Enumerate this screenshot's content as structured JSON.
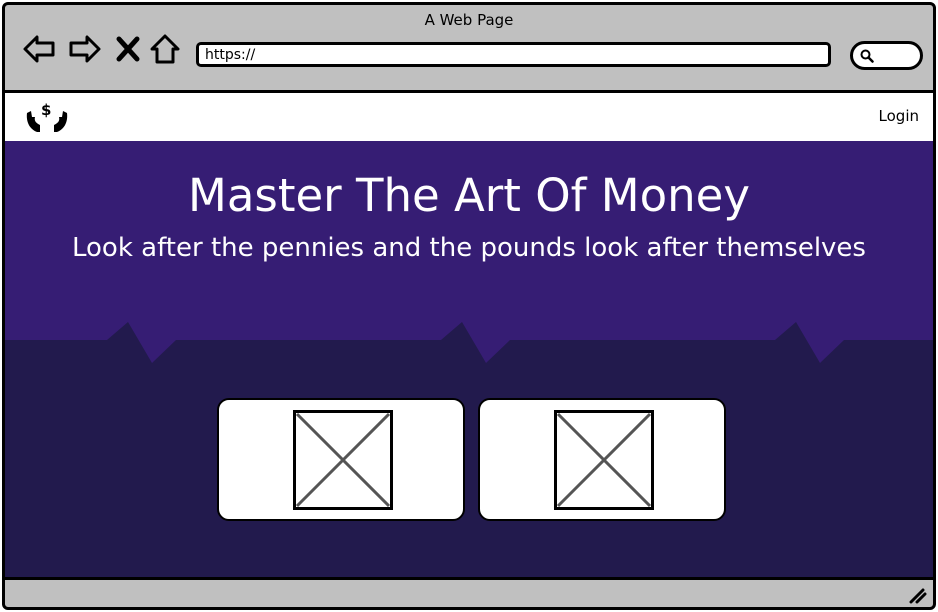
{
  "window": {
    "title": "A Web Page"
  },
  "browser": {
    "url": "https://",
    "icons": [
      "back-arrow-icon",
      "forward-arrow-icon",
      "close-x-icon",
      "home-icon",
      "search-icon"
    ]
  },
  "navbar": {
    "logo_icon": "hands-holding-dollar-icon",
    "login_label": "Login"
  },
  "hero": {
    "title": "Master The Art Of Money",
    "subtitle": "Look after the pennies and the pounds look after themselves"
  },
  "cards": [
    {
      "image": "image-placeholder-icon"
    },
    {
      "image": "image-placeholder-icon"
    }
  ],
  "colors": {
    "hero_top": "#361d74",
    "hero_bottom": "#221a4d",
    "chrome": "#c0c0c0"
  }
}
